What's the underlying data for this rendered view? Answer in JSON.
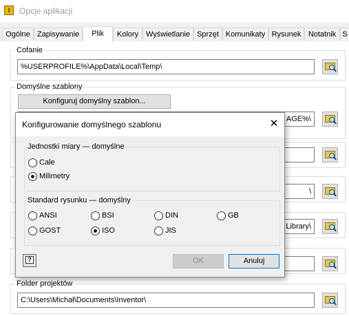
{
  "window": {
    "title": "Opcje aplikacji",
    "icon_text": "I"
  },
  "tabs": [
    {
      "label": "Ogólne"
    },
    {
      "label": "Zapisywanie"
    },
    {
      "label": "Plik",
      "active": true
    },
    {
      "label": "Kolory"
    },
    {
      "label": "Wyświetlanie"
    },
    {
      "label": "Sprzęt"
    },
    {
      "label": "Komunikaty"
    },
    {
      "label": "Rysunek"
    },
    {
      "label": "Notatnik"
    },
    {
      "label": "S"
    }
  ],
  "groups": {
    "undo": {
      "label": "Cofanie",
      "path": "%USERPROFILE%\\AppData\\Local\\Temp\\"
    },
    "templates": {
      "label": "Domyślne szablony",
      "configure_button": "Konfiguruj domyślny szablon...",
      "path_visible": "AGE%\\"
    },
    "row3": {
      "path_visible": ""
    },
    "row4": {
      "path_visible": "\\"
    },
    "row5": {
      "path_visible": "Library\\"
    },
    "row6": {
      "path_visible": ""
    },
    "projects": {
      "label": "Folder projektów",
      "path": "C:\\Users\\Michał\\Documents\\Inventor\\"
    }
  },
  "dialog": {
    "title": "Konfigurowanie domyślnego szablonu",
    "close_glyph": "✕",
    "units": {
      "legend": "Jednostki miary — domyślne",
      "options": [
        {
          "label": "Cale",
          "checked": false
        },
        {
          "label": "Milimetry",
          "checked": true
        }
      ]
    },
    "standard": {
      "legend": "Standard rysunku — domyślny",
      "options": [
        {
          "label": "ANSI",
          "checked": false
        },
        {
          "label": "BSI",
          "checked": false
        },
        {
          "label": "DIN",
          "checked": false
        },
        {
          "label": "GB",
          "checked": false
        },
        {
          "label": "GOST",
          "checked": false
        },
        {
          "label": "ISO",
          "checked": true
        },
        {
          "label": "JIS",
          "checked": false
        }
      ]
    },
    "help_glyph": "?",
    "ok_label": "OK",
    "ok_enabled": false,
    "cancel_label": "Anuluj"
  }
}
